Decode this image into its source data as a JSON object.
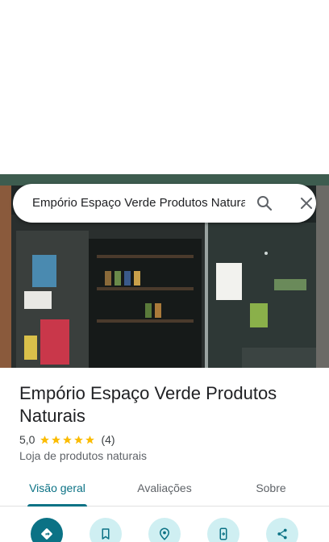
{
  "search": {
    "query": "Empório Espaço Verde Produtos Naturais"
  },
  "place": {
    "name": "Empório Espaço Verde Produtos Naturais",
    "rating": "5,0",
    "stars": 5,
    "review_count": "(4)",
    "category": "Loja de produtos naturais"
  },
  "tabs": [
    {
      "label": "Visão geral",
      "active": true
    },
    {
      "label": "Avaliações",
      "active": false
    },
    {
      "label": "Sobre",
      "active": false
    }
  ],
  "actions": [
    {
      "icon": "directions-icon",
      "primary": true
    },
    {
      "icon": "bookmark-icon",
      "primary": false
    },
    {
      "icon": "nearby-icon",
      "primary": false
    },
    {
      "icon": "send-to-phone-icon",
      "primary": false
    },
    {
      "icon": "share-icon",
      "primary": false
    }
  ],
  "colors": {
    "accent": "#0b7285",
    "star": "#fbbc04",
    "action_bg": "#cfeff2"
  }
}
